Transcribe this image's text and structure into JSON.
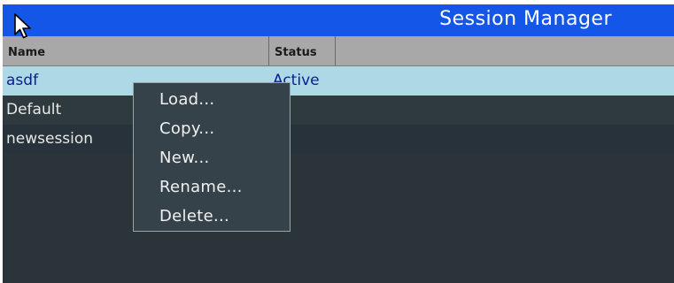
{
  "window": {
    "title": "Session Manager"
  },
  "table": {
    "columns": [
      "Name",
      "Status"
    ],
    "rows": [
      {
        "name": "asdf",
        "status": "Active",
        "selected": true
      },
      {
        "name": "Default",
        "status": ""
      },
      {
        "name": "newsession",
        "status": ""
      }
    ]
  },
  "context_menu": {
    "items": [
      "Load...",
      "Copy...",
      "New...",
      "Rename...",
      "Delete..."
    ]
  },
  "colors": {
    "titlebar": "#1457e8",
    "selected_row": "#add8e6",
    "background": "#2b3438",
    "header": "#a8a8a8"
  },
  "icons": {
    "cursor": "mouse-pointer-icon"
  }
}
